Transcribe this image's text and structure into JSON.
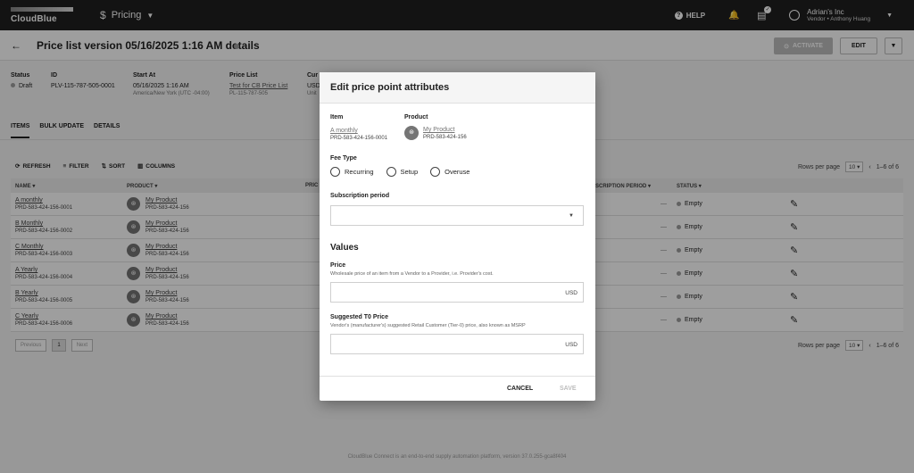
{
  "topbar": {
    "logo": "CloudBlue",
    "module": "Pricing",
    "module_icon": "dollar-icon",
    "help": "HELP",
    "account_name": "Adrian's Inc",
    "account_role": "Vendor",
    "account_user": "Anthony Huang"
  },
  "header": {
    "title": "Price list version 05/16/2025 1:16 AM details",
    "activate": "ACTIVATE",
    "edit": "EDIT"
  },
  "details": {
    "status": {
      "label": "Status",
      "value": "Draft"
    },
    "id": {
      "label": "ID",
      "value": "PLV-115-787-505-0001"
    },
    "start": {
      "label": "Start At",
      "value": "05/16/2025 1:16 AM",
      "tz": "America/New York (UTC -04:00)"
    },
    "pricelist": {
      "label": "Price List",
      "value": "Test for CB Price List",
      "id": "PL-115-787-505"
    },
    "currency": {
      "label": "Cur",
      "value": "USD",
      "sub": "Unit"
    }
  },
  "tabs": [
    "ITEMS",
    "BULK UPDATE",
    "DETAILS"
  ],
  "toolbar": {
    "refresh": "REFRESH",
    "filter": "FILTER",
    "sort": "SORT",
    "columns": "COLUMNS",
    "rows_per_page_label": "Rows per page",
    "rows_per_page": "10",
    "range": "1–6 of 6"
  },
  "table": {
    "headers": {
      "name": "NAME",
      "product": "PRODUCT",
      "price": "PRIC",
      "period": "SCRIPTION PERIOD",
      "status": "STATUS"
    },
    "rows": [
      {
        "name": "A monthly",
        "id": "PRD-583-424-156-0001",
        "product": "My Product",
        "product_id": "PRD-583-424-156",
        "period": "—",
        "status": "Empty"
      },
      {
        "name": "B Monthly",
        "id": "PRD-583-424-156-0002",
        "product": "My Product",
        "product_id": "PRD-583-424-156",
        "period": "—",
        "status": "Empty"
      },
      {
        "name": "C Monthly",
        "id": "PRD-583-424-156-0003",
        "product": "My Product",
        "product_id": "PRD-583-424-156",
        "period": "—",
        "status": "Empty"
      },
      {
        "name": "A Yearly",
        "id": "PRD-583-424-156-0004",
        "product": "My Product",
        "product_id": "PRD-583-424-156",
        "period": "—",
        "status": "Empty"
      },
      {
        "name": "B Yearly",
        "id": "PRD-583-424-156-0005",
        "product": "My Product",
        "product_id": "PRD-583-424-156",
        "period": "—",
        "status": "Empty"
      },
      {
        "name": "C Yearly",
        "id": "PRD-583-424-156-0006",
        "product": "My Product",
        "product_id": "PRD-583-424-156",
        "period": "—",
        "status": "Empty"
      }
    ]
  },
  "pager": {
    "previous": "Previous",
    "page": "1",
    "next": "Next"
  },
  "footer": "CloudBlue Connect is an end-to-end supply automation platform, version 37.0.255-gca8f404",
  "dialog": {
    "title": "Edit price point attributes",
    "item_label": "Item",
    "item_name": "A monthly",
    "item_id": "PRD-583-424-156-0001",
    "product_label": "Product",
    "product_name": "My Product",
    "product_id": "PRD-583-424-156",
    "fee_type_label": "Fee Type",
    "fee_types": [
      "Recurring",
      "Setup",
      "Overuse"
    ],
    "subscription_label": "Subscription period",
    "subscription_value": "",
    "values_title": "Values",
    "price_label": "Price",
    "price_help": "Wholesale price of an item from a Vendor to a Provider, i.e. Provider's cost.",
    "price_unit": "USD",
    "msrp_label": "Suggested T0 Price",
    "msrp_help": "Vendor's (manufacturer's) suggested Retail Customer (Tier-0) price, also known as MSRP",
    "msrp_unit": "USD",
    "cancel": "CANCEL",
    "save": "SAVE"
  }
}
